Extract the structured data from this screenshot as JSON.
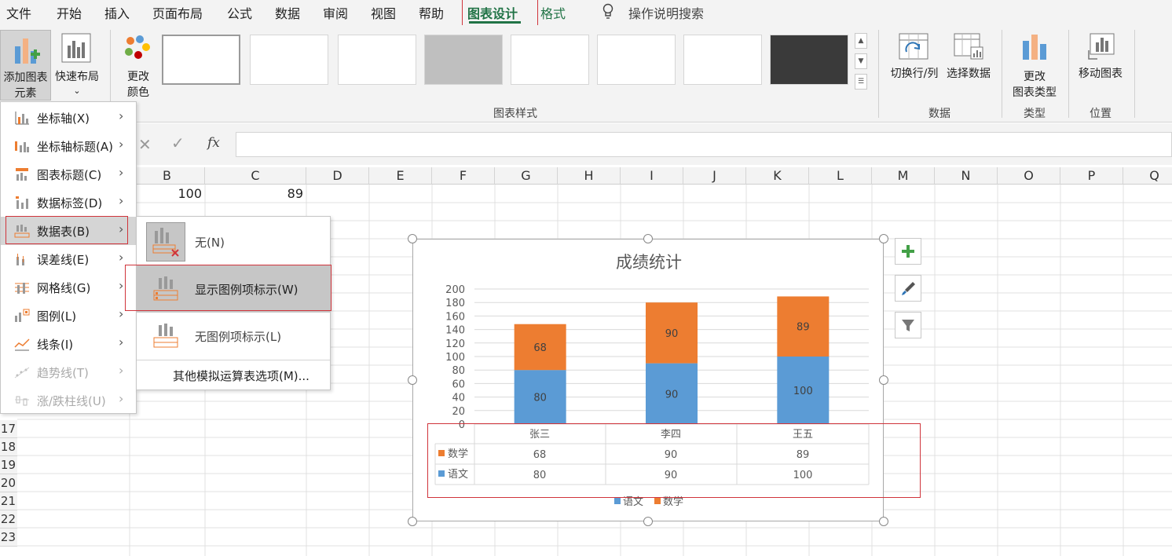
{
  "tabs": [
    "文件",
    "开始",
    "插入",
    "页面布局",
    "公式",
    "数据",
    "审阅",
    "视图",
    "帮助",
    "图表设计",
    "格式"
  ],
  "tell_me": "操作说明搜索",
  "ribbon": {
    "add_element_line1": "添加图表",
    "add_element_line2": "元素",
    "quick_layout": "快速布局",
    "change_colors_line1": "更改",
    "change_colors_line2": "颜色",
    "chart_styles_group": "图表样式",
    "switch_row_col": "切换行/列",
    "select_data": "选择数据",
    "data_group": "数据",
    "change_type_line1": "更改",
    "change_type_line2": "图表类型",
    "type_group": "类型",
    "move_chart": "移动图表",
    "location_group": "位置",
    "colors": {
      "orange": "#ED7D31",
      "blue": "#5B9BD5",
      "green": "#217346",
      "red": "#D0343B"
    }
  },
  "columns": [
    "B",
    "C",
    "D",
    "E",
    "F",
    "G",
    "H",
    "I",
    "J",
    "K",
    "L",
    "M",
    "N",
    "O",
    "P",
    "Q"
  ],
  "rows": [
    "17",
    "18",
    "19",
    "20",
    "21",
    "22",
    "23"
  ],
  "cells": {
    "b1": "100",
    "c1": "89"
  },
  "menu": {
    "items": [
      {
        "label": "坐标轴(X)",
        "icon": "axis-icon"
      },
      {
        "label": "坐标轴标题(A)",
        "icon": "axis-title-icon"
      },
      {
        "label": "图表标题(C)",
        "icon": "chart-title-icon"
      },
      {
        "label": "数据标签(D)",
        "icon": "data-labels-icon"
      },
      {
        "label": "数据表(B)",
        "icon": "data-table-icon"
      },
      {
        "label": "误差线(E)",
        "icon": "error-bars-icon"
      },
      {
        "label": "网格线(G)",
        "icon": "gridlines-icon"
      },
      {
        "label": "图例(L)",
        "icon": "legend-icon"
      },
      {
        "label": "线条(I)",
        "icon": "lines-icon"
      },
      {
        "label": "趋势线(T)",
        "icon": "trendline-icon"
      },
      {
        "label": "涨/跌柱线(U)",
        "icon": "up-down-bars-icon"
      }
    ]
  },
  "submenu": {
    "none": "无(N)",
    "with_legend": "显示图例项标示(W)",
    "no_legend": "无图例项标示(L)",
    "more": "其他模拟运算表选项(M)..."
  },
  "chart_data": {
    "type": "bar",
    "stacked": true,
    "title": "成绩统计",
    "categories": [
      "张三",
      "李四",
      "王五"
    ],
    "series": [
      {
        "name": "语文",
        "values": [
          80,
          90,
          100
        ],
        "color": "#5B9BD5"
      },
      {
        "name": "数学",
        "values": [
          68,
          90,
          89
        ],
        "color": "#ED7D31"
      }
    ],
    "ylim": [
      0,
      200
    ],
    "yticks": [
      0,
      20,
      40,
      60,
      80,
      100,
      120,
      140,
      160,
      180,
      200
    ],
    "grid": true,
    "legend": "bottom",
    "data_table": {
      "rows": [
        {
          "name": "数学",
          "values": [
            "68",
            "90",
            "89"
          ]
        },
        {
          "name": "语文",
          "values": [
            "80",
            "90",
            "100"
          ]
        }
      ]
    }
  }
}
